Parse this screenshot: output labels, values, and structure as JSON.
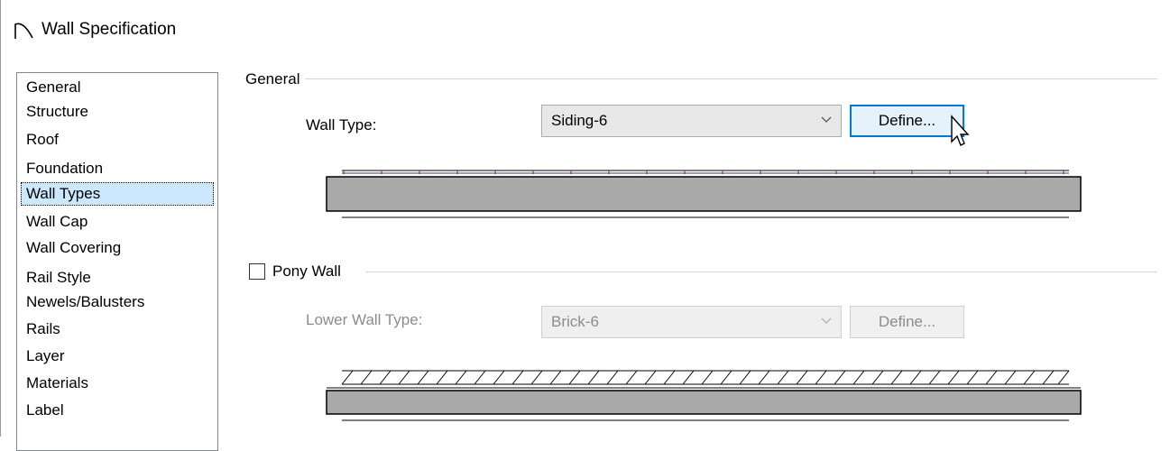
{
  "window": {
    "title": "Wall Specification",
    "icon": "roof-arc-icon"
  },
  "nav": {
    "items": [
      {
        "label": "General",
        "selected": false
      },
      {
        "label": "Structure",
        "selected": false
      },
      {
        "label": "Roof",
        "selected": false
      },
      {
        "label": "Foundation",
        "selected": false
      },
      {
        "label": "Wall Types",
        "selected": true
      },
      {
        "label": "Wall Cap",
        "selected": false
      },
      {
        "label": "Wall Covering",
        "selected": false
      },
      {
        "label": "Rail Style",
        "selected": false
      },
      {
        "label": "Newels/Balusters",
        "selected": false
      },
      {
        "label": "Rails",
        "selected": false
      },
      {
        "label": "Layer",
        "selected": false
      },
      {
        "label": "Materials",
        "selected": false
      },
      {
        "label": "Label",
        "selected": false
      }
    ]
  },
  "general": {
    "group_label": "General",
    "wall_type_label": "Wall Type:",
    "wall_type_value": "Siding-6",
    "define_label": "Define..."
  },
  "pony": {
    "checkbox_label": "Pony Wall",
    "checked": false,
    "lower_wall_type_label": "Lower Wall Type:",
    "lower_wall_type_value": "Brick-6",
    "define_label": "Define..."
  },
  "colors": {
    "selection": "#cce8ff",
    "focus_border": "#0078d7",
    "wall_fill": "#a9a9a9",
    "siding_accent": "#5a2a6a"
  }
}
